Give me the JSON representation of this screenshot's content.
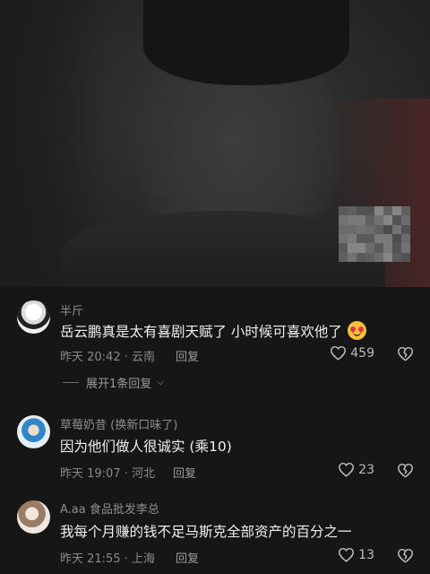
{
  "comments": [
    {
      "name": "半斤",
      "text": "岳云鹏真是太有喜剧天赋了 小时候可喜欢他了",
      "time": "昨天 20:42 · 云南",
      "reply": "回复",
      "likes": "459",
      "emoji": "heart-eyes-emoji"
    },
    {
      "name": "草莓奶昔 (换新口味了)",
      "text": "因为他们做人很诚实 (乘10)",
      "time": "昨天 19:07 · 河北",
      "reply": "回复",
      "likes": "23"
    },
    {
      "name": "A.aa 食品批发李总",
      "text": "我每个月赚的钱不足马斯克全部资产的百分之一",
      "time": "昨天 21:55 · 上海",
      "reply": "回复",
      "likes": "13"
    }
  ],
  "expand_replies": "展开1条回复",
  "icons": {
    "like": "heart-outline-icon",
    "dislike": "broken-heart-icon",
    "expand": "chevron-down-icon"
  },
  "colors": {
    "background": "#161616",
    "text_primary": "#f0f0f0",
    "text_secondary": "#8a8a8a"
  }
}
